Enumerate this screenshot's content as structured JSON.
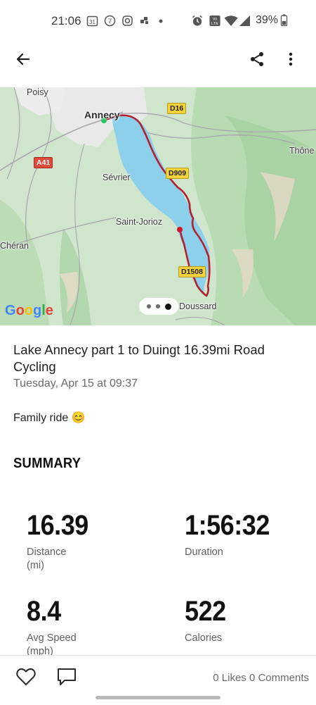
{
  "status_bar": {
    "time": "21:06",
    "battery": "39%",
    "notification_icons": [
      "calendar-icon",
      "badge-7-icon",
      "instagram-icon",
      "app-icon",
      "dot-icon"
    ],
    "system_icons": [
      "alarm-icon",
      "volte-icon",
      "wifi-icon",
      "signal-icon",
      "battery-icon"
    ]
  },
  "app_bar": {
    "back_icon": "arrow-left-icon",
    "share_icon": "share-icon",
    "more_icon": "more-vertical-icon"
  },
  "map": {
    "labels": {
      "poisy": "Poisy",
      "annecy": "Annecy",
      "sevrier": "Sévrier",
      "saint_jorioz": "Saint-Jorioz",
      "cheran": "Chéran",
      "thones": "Thône",
      "doussard": "Doussard"
    },
    "roads": {
      "d16": "D16",
      "d909": "D909",
      "a41": "A41",
      "d1508": "D1508"
    },
    "logo": "Google",
    "colors": {
      "route": "#b3202f",
      "water": "#8dd0ec",
      "start": "#22c55e",
      "end": "#d0182b"
    }
  },
  "activity": {
    "title": "Lake Annecy part 1 to Duingt 16.39mi Road Cycling",
    "date": "Tuesday, Apr 15 at 09:37",
    "description": "Family ride 😊"
  },
  "summary": {
    "title": "SUMMARY",
    "stats": [
      {
        "value": "16.39",
        "label": "Distance",
        "unit": "(mi)"
      },
      {
        "value": "1:56:32",
        "label": "Duration",
        "unit": ""
      },
      {
        "value": "8.4",
        "label": "Avg Speed",
        "unit": "(mph)"
      },
      {
        "value": "522",
        "label": "Calories",
        "unit": ""
      }
    ]
  },
  "footer": {
    "like_icon": "heart-icon",
    "comment_icon": "comment-icon",
    "likes_text": "0 Likes",
    "comments_text": "0 Comments"
  }
}
